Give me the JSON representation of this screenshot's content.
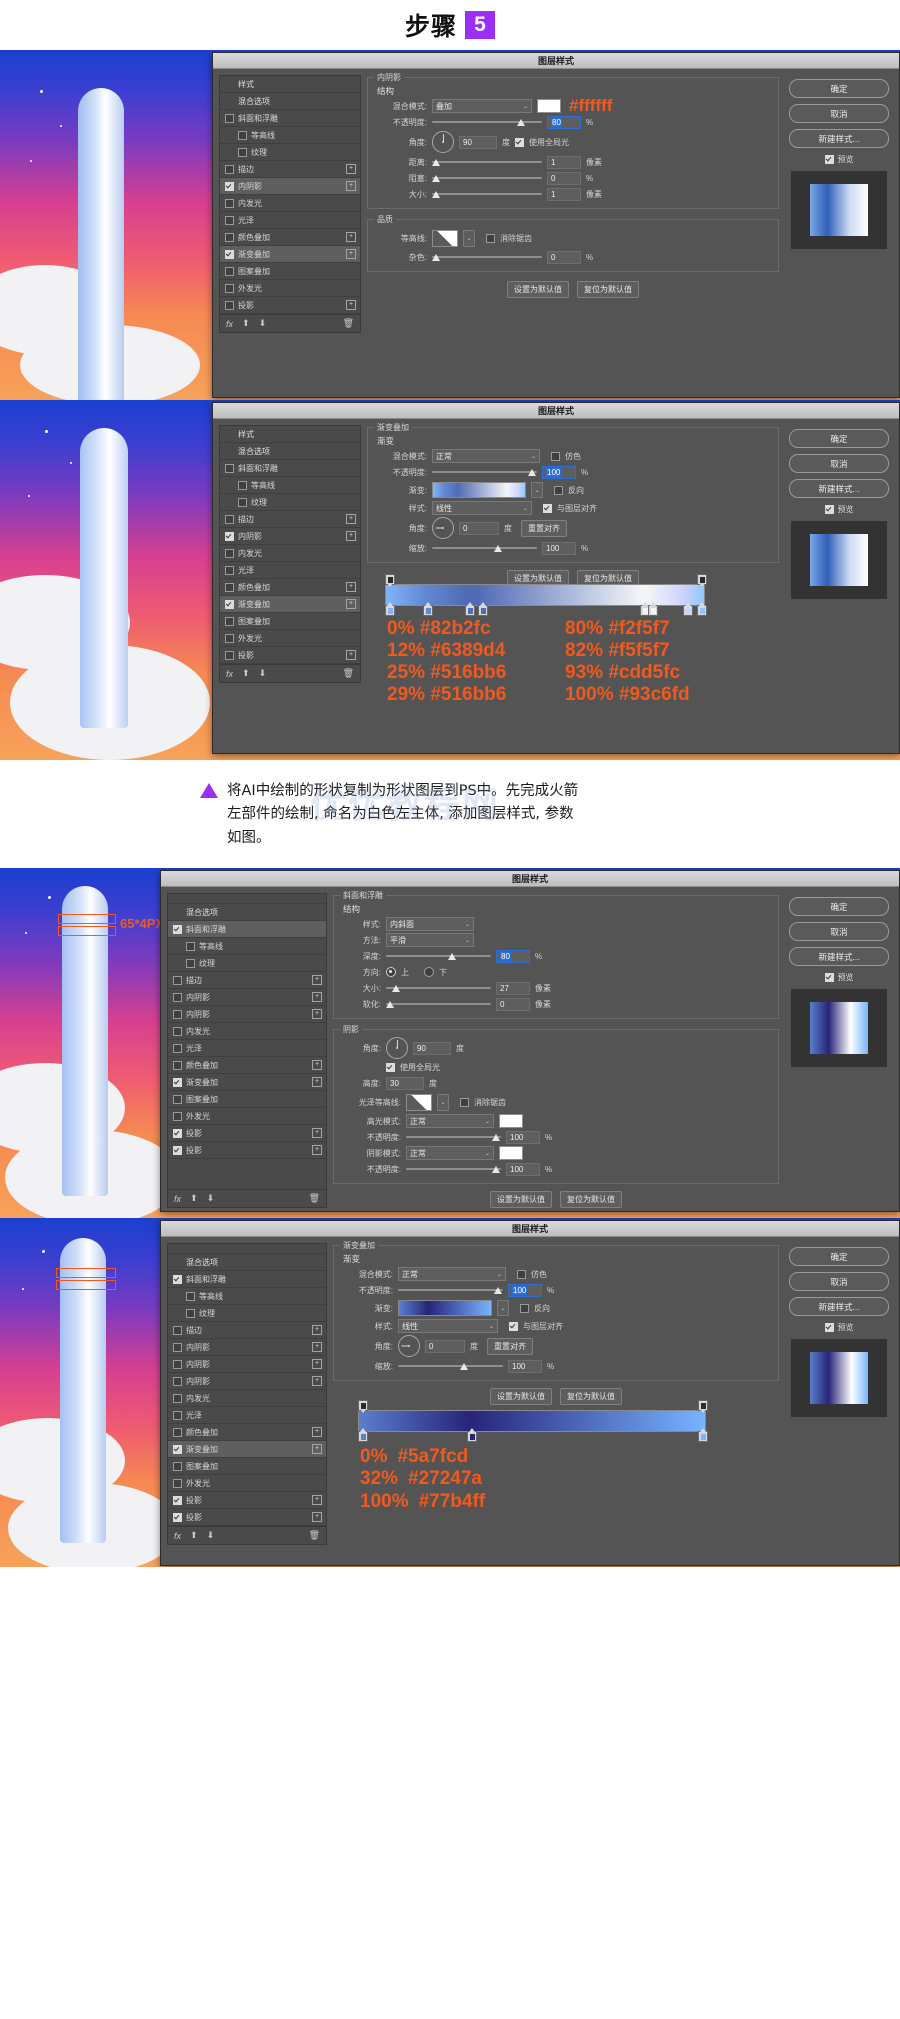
{
  "header": {
    "title": "步骤",
    "step": "5"
  },
  "dialog_title": "图层样式",
  "buttons": {
    "ok": "确定",
    "cancel": "取消",
    "new_style": "新建样式...",
    "preview": "预览"
  },
  "footer_buttons": {
    "set_default": "设置为默认值",
    "reset_default": "复位为默认值"
  },
  "style_list_header": {
    "styles": "样式",
    "blending": "混合选项"
  },
  "effects": {
    "bevel": "斜面和浮雕",
    "contour": "等高线",
    "texture": "纹理",
    "stroke": "描边",
    "inner_shadow": "内阴影",
    "inner_glow": "内发光",
    "satin": "光泽",
    "color_overlay": "颜色叠加",
    "gradient_overlay": "渐变叠加",
    "pattern_overlay": "图案叠加",
    "outer_glow": "外发光",
    "drop_shadow": "投影"
  },
  "labels": {
    "structure": "结构",
    "quality": "品质",
    "shadow": "阴影",
    "gradient_group": "渐变",
    "blend_mode": "混合模式:",
    "opacity": "不透明度:",
    "angle": "角度:",
    "distance": "距离:",
    "choke": "阻塞:",
    "size": "大小:",
    "contour_label": "等高线:",
    "noise": "杂色:",
    "use_global_light": "使用全局光",
    "anti_alias": "消除锯齿",
    "degree": "度",
    "pixel": "像素",
    "percent": "%",
    "gradient": "渐变:",
    "style": "样式:",
    "scale": "缩放:",
    "reverse": "反向",
    "align_with_layer": "与图层对齐",
    "reset_align": "重置对齐",
    "dither": "仿色",
    "method": "方法:",
    "depth": "深度:",
    "direction": "方向:",
    "up": "上",
    "down": "下",
    "soften": "软化:",
    "altitude": "高度:",
    "gloss_contour": "光泽等高线:",
    "highlight_mode": "高光模式:",
    "shadow_mode": "阴影模式:"
  },
  "panel1": {
    "section": "内阴影",
    "blend_mode": "叠加",
    "opacity": "80",
    "angle": "90",
    "distance": "1",
    "choke": "0",
    "size": "1",
    "noise": "0",
    "hex_note": "#ffffff",
    "use_global_light": true,
    "anti_alias": false
  },
  "panel2": {
    "section": "渐变叠加",
    "blend_mode": "正常",
    "opacity": "100",
    "style": "线性",
    "angle": "0",
    "scale": "100",
    "dither": false,
    "reverse": false,
    "align_with_layer": true,
    "gradient_stops": [
      {
        "pos": "0%",
        "hex": "#82b2fc"
      },
      {
        "pos": "12%",
        "hex": "#6389d4"
      },
      {
        "pos": "25%",
        "hex": "#516bb6"
      },
      {
        "pos": "29%",
        "hex": "#516bb6"
      },
      {
        "pos": "80%",
        "hex": "#f2f5f7"
      },
      {
        "pos": "82%",
        "hex": "#f5f5f7"
      },
      {
        "pos": "93%",
        "hex": "#cdd5fc"
      },
      {
        "pos": "100%",
        "hex": "#93c6fd"
      }
    ]
  },
  "caption": {
    "line1": "将AI中绘制的形状复制为形状图层到PS中。先完成火箭",
    "line2": "左部件的绘制, 命名为白色左主体, 添加图层样式, 参数",
    "line3": "如图。",
    "watermark": "优优教程网"
  },
  "panel3": {
    "section": "斜面和浮雕",
    "style": "内斜面",
    "method": "平滑",
    "depth": "80",
    "direction_up": true,
    "size": "27",
    "soften": "0",
    "angle": "90",
    "use_global_light": true,
    "altitude": "30",
    "anti_alias": false,
    "highlight_mode": "正常",
    "highlight_opacity": "100",
    "shadow_mode": "正常",
    "shadow_opacity": "100",
    "annotation": "65*4PX"
  },
  "panel4": {
    "section": "渐变叠加",
    "blend_mode": "正常",
    "opacity": "100",
    "style": "线性",
    "angle": "0",
    "scale": "100",
    "dither": false,
    "reverse": false,
    "align_with_layer": true,
    "gradient_stops": [
      {
        "pos": "0%",
        "hex": "#5a7fcd"
      },
      {
        "pos": "32%",
        "hex": "#27247a"
      },
      {
        "pos": "100%",
        "hex": "#77b4ff"
      }
    ]
  },
  "colors": {
    "accent": "#f05a1e",
    "purple": "#9b2ff7",
    "dialog_bg": "#545454"
  }
}
